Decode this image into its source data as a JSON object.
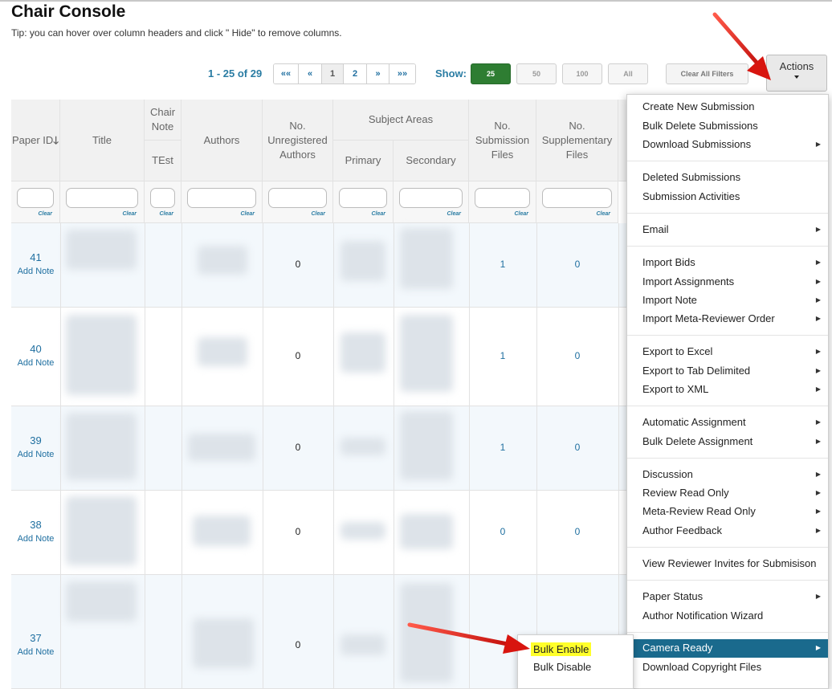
{
  "page": {
    "title": "Chair Console",
    "tip": "Tip: you can hover over column headers and click \" Hide\" to remove columns."
  },
  "pagination": {
    "range": "1 - 25 of 29",
    "buttons": [
      "««",
      "«",
      "1",
      "2",
      "»",
      "»»"
    ],
    "current": "1"
  },
  "show": {
    "label": "Show:",
    "options": [
      "25",
      "50",
      "100",
      "All"
    ],
    "selected": "25"
  },
  "toolbar": {
    "clear_filters": "Clear All Filters",
    "actions": "Actions"
  },
  "table": {
    "headers": {
      "paper_id": "Paper ID",
      "sort_icon": "sort-down-arrow-icon",
      "title": "Title",
      "chair_note": "Chair Note",
      "chair_note_sub": "TEst",
      "authors": "Authors",
      "unregistered": "No. Unregistered Authors",
      "subject_areas": "Subject Areas",
      "primary": "Primary",
      "secondary": "Secondary",
      "submission_files": "No. Submission Files",
      "supplementary_files": "No. Supplementary Files"
    },
    "filter_clear_label": "Clear",
    "add_note_label": "Add Note",
    "rows": [
      {
        "id": "41",
        "unregistered": "0",
        "submission_files": "1",
        "supplementary_files": "0"
      },
      {
        "id": "40",
        "unregistered": "0",
        "submission_files": "1",
        "supplementary_files": "0"
      },
      {
        "id": "39",
        "unregistered": "0",
        "submission_files": "1",
        "supplementary_files": "0"
      },
      {
        "id": "38",
        "unregistered": "0",
        "submission_files": "0",
        "supplementary_files": "0"
      },
      {
        "id": "37",
        "unregistered": "0",
        "submission_files": "",
        "supplementary_files": ""
      }
    ]
  },
  "actions_menu": {
    "items": [
      {
        "label": "Create New Submission",
        "submenu": false
      },
      {
        "label": "Bulk Delete Submissions",
        "submenu": false
      },
      {
        "label": "Download Submissions",
        "submenu": true
      },
      {
        "label": "Deleted Submissions",
        "submenu": false
      },
      {
        "label": "Submission Activities",
        "submenu": false
      },
      {
        "label": "Email",
        "submenu": true
      },
      {
        "label": "Import Bids",
        "submenu": true
      },
      {
        "label": "Import Assignments",
        "submenu": true
      },
      {
        "label": "Import Note",
        "submenu": true
      },
      {
        "label": "Import Meta-Reviewer Order",
        "submenu": true
      },
      {
        "label": "Export to Excel",
        "submenu": true
      },
      {
        "label": "Export to Tab Delimited",
        "submenu": true
      },
      {
        "label": "Export to XML",
        "submenu": true
      },
      {
        "label": "Automatic Assignment",
        "submenu": true
      },
      {
        "label": "Bulk Delete Assignment",
        "submenu": true
      },
      {
        "label": "Discussion",
        "submenu": true
      },
      {
        "label": "Review Read Only",
        "submenu": true
      },
      {
        "label": "Meta-Review Read Only",
        "submenu": true
      },
      {
        "label": "Author Feedback",
        "submenu": true
      },
      {
        "label": "View Reviewer Invites for Submisison",
        "submenu": false
      },
      {
        "label": "Paper Status",
        "submenu": true
      },
      {
        "label": "Author Notification Wizard",
        "submenu": false
      },
      {
        "label": "Camera Ready",
        "submenu": true,
        "highlighted": true
      },
      {
        "label": "Download Copyright Files",
        "submenu": false
      }
    ]
  },
  "camera_ready_submenu": {
    "items": [
      "Bulk Enable",
      "Bulk Disable"
    ],
    "highlighted": "Bulk Enable"
  },
  "colors": {
    "link": "#1f6fa0",
    "menu_highlight": "#1a6a8d",
    "show_active": "#2e7d32",
    "annotation_arrow": "#e8231f",
    "highlight_marker": "#ffff2a"
  }
}
